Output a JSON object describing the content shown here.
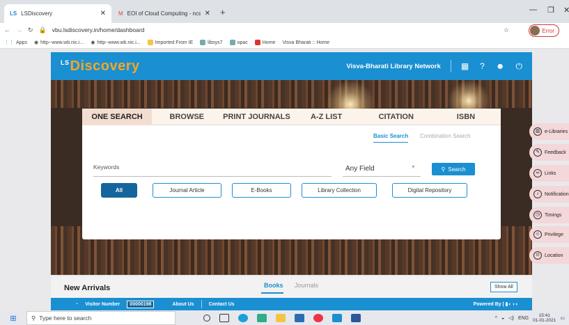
{
  "browser": {
    "tabs": [
      {
        "label": "LSDiscovery"
      },
      {
        "label": "EOI of Cloud Computing - ncsal"
      }
    ],
    "url": "vbu.lsdiscovery.in/home/dashboard",
    "error_label": "Error",
    "bookmarks": [
      "Apps",
      "http--www.wb.nic.i...",
      "http--www.wb.nic.i...",
      "Imported From IE",
      "libsys7",
      "opac",
      "Home",
      "Visva Bharati :: Home"
    ]
  },
  "header": {
    "logo_ls": "LS",
    "logo_rest": "Discovery",
    "network": "Visva-Bharati Library Network"
  },
  "search": {
    "tabs": [
      "ONE SEARCH",
      "BROWSE",
      "PRINT JOURNALS",
      "A-Z LIST",
      "CITATION",
      "ISBN"
    ],
    "basic": "Basic Search",
    "combination": "Combination Search",
    "keywords_placeholder": "Keywords",
    "field": "Any Field",
    "button": "Search",
    "filters": [
      "All",
      "Journal Article",
      "E-Books",
      "Library Collection",
      "Digital Repository"
    ]
  },
  "side_panel": [
    "e-Libraries",
    "Feedback",
    "Links",
    "Notification",
    "Timings",
    "Privilege",
    "Location"
  ],
  "arrivals": {
    "title": "New Arrivals",
    "books": "Books",
    "journals": "Journals",
    "show_all": "Show All"
  },
  "footer": {
    "visitor_label": "Visitor Number",
    "visitor_number": "00000198",
    "about": "About Us",
    "contact": "Contact Us",
    "powered": "Powered By"
  },
  "taskbar": {
    "search": "Type here to search",
    "lang": "ENG",
    "time": "15:41",
    "date": "01-01-2021"
  },
  "colors": {
    "primary": "#1a8fd1",
    "accent": "#f5a623"
  }
}
